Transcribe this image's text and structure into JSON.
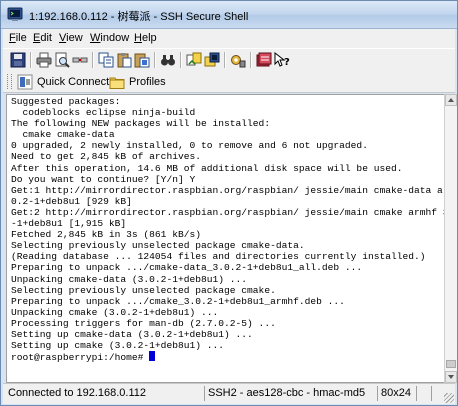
{
  "window": {
    "title": "1:192.168.0.112 - 树莓派 - SSH Secure Shell"
  },
  "menu": [
    {
      "label": "File",
      "u": "F",
      "rest": "ile"
    },
    {
      "label": "Edit",
      "u": "E",
      "rest": "dit"
    },
    {
      "label": "View",
      "u": "V",
      "rest": "iew"
    },
    {
      "label": "Window",
      "u": "W",
      "rest": "indow"
    },
    {
      "label": "Help",
      "u": "H",
      "rest": "elp"
    }
  ],
  "toolbar_icons": [
    "save-icon",
    "print-icon",
    "print-preview-icon",
    "disconnect-icon",
    "copy-icon",
    "paste-icon",
    "paste-special-icon",
    "find-icon",
    "file-transfer-icon",
    "new-terminal-icon",
    "settings-icon",
    "profile-icon",
    "help-icon"
  ],
  "profilebar": {
    "quick_connect": "Quick Connect",
    "profiles": "Profiles"
  },
  "terminal": {
    "lines": [
      "Suggested packages:",
      "  codeblocks eclipse ninja-build",
      "The following NEW packages will be installed:",
      "  cmake cmake-data",
      "0 upgraded, 2 newly installed, 0 to remove and 6 not upgraded.",
      "Need to get 2,845 kB of archives.",
      "After this operation, 14.6 MB of additional disk space will be used.",
      "Do you want to continue? [Y/n] Y",
      "Get:1 http://mirrordirector.raspbian.org/raspbian/ jessie/main cmake-data all 3.",
      "0.2-1+deb8u1 [929 kB]",
      "Get:2 http://mirrordirector.raspbian.org/raspbian/ jessie/main cmake armhf 3.0.2",
      "-1+deb8u1 [1,915 kB]",
      "Fetched 2,845 kB in 3s (861 kB/s)",
      "Selecting previously unselected package cmake-data.",
      "(Reading database ... 124054 files and directories currently installed.)",
      "Preparing to unpack .../cmake-data_3.0.2-1+deb8u1_all.deb ...",
      "Unpacking cmake-data (3.0.2-1+deb8u1) ...",
      "Selecting previously unselected package cmake.",
      "Preparing to unpack .../cmake_3.0.2-1+deb8u1_armhf.deb ...",
      "Unpacking cmake (3.0.2-1+deb8u1) ...",
      "Processing triggers for man-db (2.7.0.2-5) ...",
      "Setting up cmake-data (3.0.2-1+deb8u1) ...",
      "Setting up cmake (3.0.2-1+deb8u1) ..."
    ],
    "prompt": "root@raspberrypi:/home# "
  },
  "status": {
    "connection": "Connected to 192.168.0.112",
    "cipher": "SSH2 - aes128-cbc - hmac-md5",
    "size": "80x24"
  }
}
